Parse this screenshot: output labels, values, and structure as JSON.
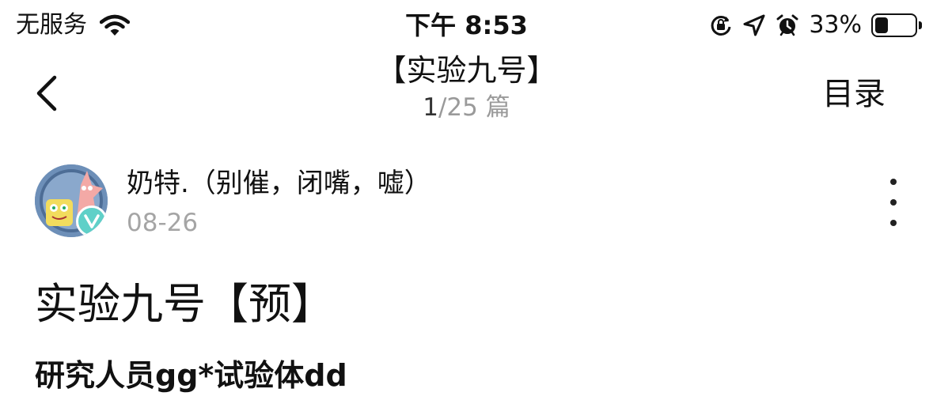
{
  "status_bar": {
    "carrier": "无服务",
    "time": "下午 8:53",
    "battery_percent": "33%",
    "battery_level": 0.33,
    "icons": [
      "wifi-icon",
      "orientation-lock-icon",
      "location-arrow-icon",
      "alarm-clock-icon",
      "battery-icon"
    ]
  },
  "nav": {
    "title": "【实验九号】",
    "page_current": "1",
    "page_rest": "/25 篇",
    "toc_label": "目录",
    "back_icon": "chevron-left-icon"
  },
  "author": {
    "name": "奶特.（别催，闭嘴，嘘）",
    "date": "08-26",
    "badge_icon": "verified-v-icon",
    "more_icon": "more-vertical-icon"
  },
  "post": {
    "title": "实验九号【预】",
    "subtitle": "研究人员gg*试验体dd"
  },
  "colors": {
    "text": "#111111",
    "muted": "#a5a5a5",
    "badge": "#5fd0c8",
    "avatar_bg": "#6d8fb8"
  }
}
